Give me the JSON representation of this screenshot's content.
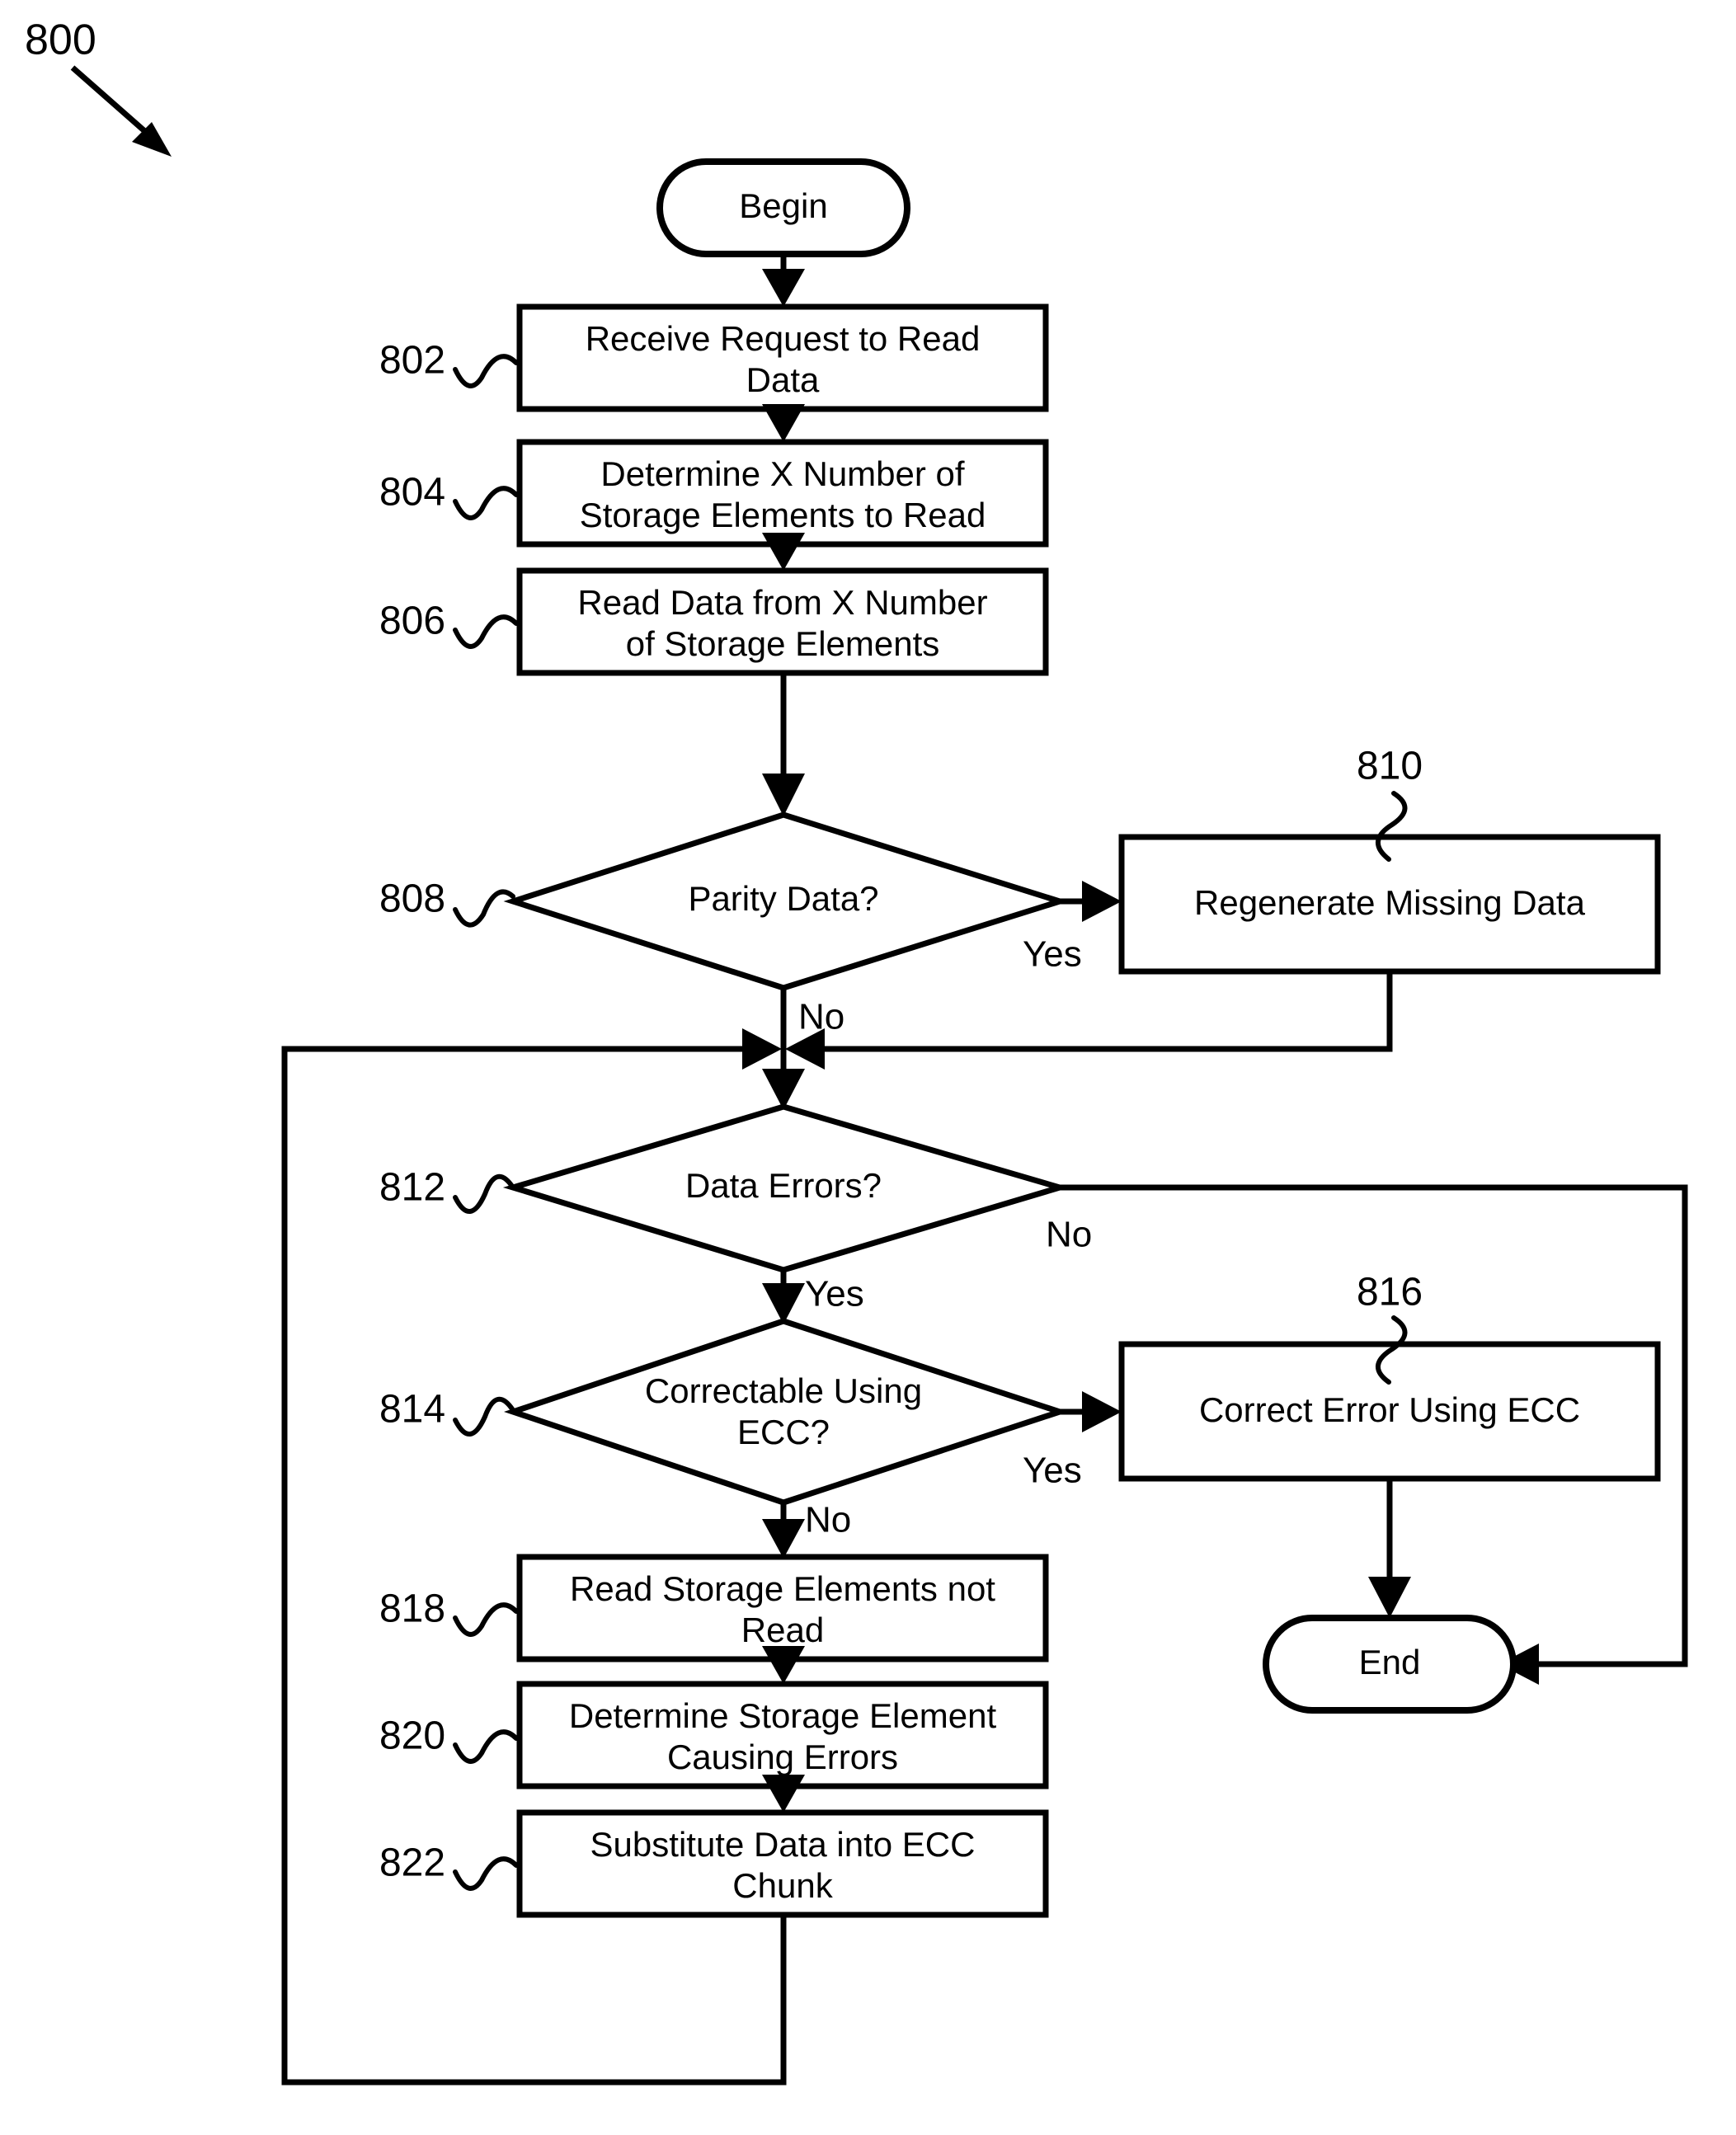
{
  "figure": {
    "number": "800",
    "pointer_icon": "arrow-down-right-icon"
  },
  "chart_data": {
    "type": "flowchart",
    "title": "800",
    "orientation": "top-to-bottom",
    "nodes": [
      {
        "id": "begin",
        "ref": "",
        "shape": "terminator",
        "text": "Begin"
      },
      {
        "id": "n802",
        "ref": "802",
        "shape": "process",
        "text": "Receive Request to Read Data",
        "lines": [
          "Receive Request to Read",
          "Data"
        ]
      },
      {
        "id": "n804",
        "ref": "804",
        "shape": "process",
        "text": "Determine X Number of Storage Elements to Read",
        "lines": [
          "Determine X Number of",
          "Storage Elements to Read"
        ]
      },
      {
        "id": "n806",
        "ref": "806",
        "shape": "process",
        "text": "Read Data from X Number of Storage Elements",
        "lines": [
          "Read Data from X Number",
          "of Storage Elements"
        ]
      },
      {
        "id": "n808",
        "ref": "808",
        "shape": "decision",
        "text": "Parity Data?",
        "lines": [
          "Parity Data?"
        ]
      },
      {
        "id": "n810",
        "ref": "810",
        "shape": "process",
        "text": "Regenerate Missing Data",
        "lines": [
          "Regenerate Missing Data"
        ]
      },
      {
        "id": "n812",
        "ref": "812",
        "shape": "decision",
        "text": "Data Errors?",
        "lines": [
          "Data Errors?"
        ]
      },
      {
        "id": "n814",
        "ref": "814",
        "shape": "decision",
        "text": "Correctable Using ECC?",
        "lines": [
          "Correctable Using",
          "ECC?"
        ]
      },
      {
        "id": "n816",
        "ref": "816",
        "shape": "process",
        "text": "Correct Error Using ECC",
        "lines": [
          "Correct Error Using ECC"
        ]
      },
      {
        "id": "n818",
        "ref": "818",
        "shape": "process",
        "text": "Read Storage Elements not Read",
        "lines": [
          "Read Storage Elements not",
          "Read"
        ]
      },
      {
        "id": "n820",
        "ref": "820",
        "shape": "process",
        "text": "Determine Storage Element Causing Errors",
        "lines": [
          "Determine Storage Element",
          "Causing Errors"
        ]
      },
      {
        "id": "n822",
        "ref": "822",
        "shape": "process",
        "text": "Substitute Data into ECC Chunk",
        "lines": [
          "Substitute Data into ECC",
          "Chunk"
        ]
      },
      {
        "id": "end",
        "ref": "",
        "shape": "terminator",
        "text": "End"
      }
    ],
    "edges": [
      {
        "from": "begin",
        "to": "n802",
        "label": ""
      },
      {
        "from": "n802",
        "to": "n804",
        "label": ""
      },
      {
        "from": "n804",
        "to": "n806",
        "label": ""
      },
      {
        "from": "n806",
        "to": "n808",
        "label": ""
      },
      {
        "from": "n808",
        "to": "n810",
        "label": "Yes"
      },
      {
        "from": "n808",
        "to": "n812",
        "label": "No"
      },
      {
        "from": "n810",
        "to": "n812",
        "label": ""
      },
      {
        "from": "n812",
        "to": "end",
        "label": "No"
      },
      {
        "from": "n812",
        "to": "n814",
        "label": "Yes"
      },
      {
        "from": "n814",
        "to": "n816",
        "label": "Yes"
      },
      {
        "from": "n814",
        "to": "n818",
        "label": "No"
      },
      {
        "from": "n816",
        "to": "end",
        "label": ""
      },
      {
        "from": "n818",
        "to": "n820",
        "label": ""
      },
      {
        "from": "n820",
        "to": "n822",
        "label": ""
      },
      {
        "from": "n822",
        "to": "n812",
        "label": ""
      }
    ],
    "edge_labels": [
      "Yes",
      "No",
      "No",
      "Yes",
      "Yes",
      "No"
    ]
  },
  "nodes": {
    "begin": {
      "text": "Begin"
    },
    "n802": {
      "ref": "802",
      "line1": "Receive Request to Read",
      "line2": "Data"
    },
    "n804": {
      "ref": "804",
      "line1": "Determine X Number of",
      "line2": "Storage Elements to Read"
    },
    "n806": {
      "ref": "806",
      "line1": "Read Data from X Number",
      "line2": "of Storage Elements"
    },
    "n808": {
      "ref": "808",
      "line1": "Parity Data?"
    },
    "n810": {
      "ref": "810",
      "line1": "Regenerate Missing Data"
    },
    "n812": {
      "ref": "812",
      "line1": "Data Errors?"
    },
    "n814": {
      "ref": "814",
      "line1": "Correctable Using",
      "line2": "ECC?"
    },
    "n816": {
      "ref": "816",
      "line1": "Correct Error Using ECC"
    },
    "n818": {
      "ref": "818",
      "line1": "Read Storage Elements not",
      "line2": "Read"
    },
    "n820": {
      "ref": "820",
      "line1": "Determine Storage Element",
      "line2": "Causing Errors"
    },
    "n822": {
      "ref": "822",
      "line1": "Substitute Data into ECC",
      "line2": "Chunk"
    },
    "end": {
      "text": "End"
    }
  },
  "labels": {
    "parity_yes": "Yes",
    "parity_no": "No",
    "errors_no": "No",
    "errors_yes": "Yes",
    "ecc_yes": "Yes",
    "ecc_no": "No"
  },
  "colors": {
    "stroke": "#000000",
    "fill": "#ffffff",
    "text": "#000000"
  }
}
